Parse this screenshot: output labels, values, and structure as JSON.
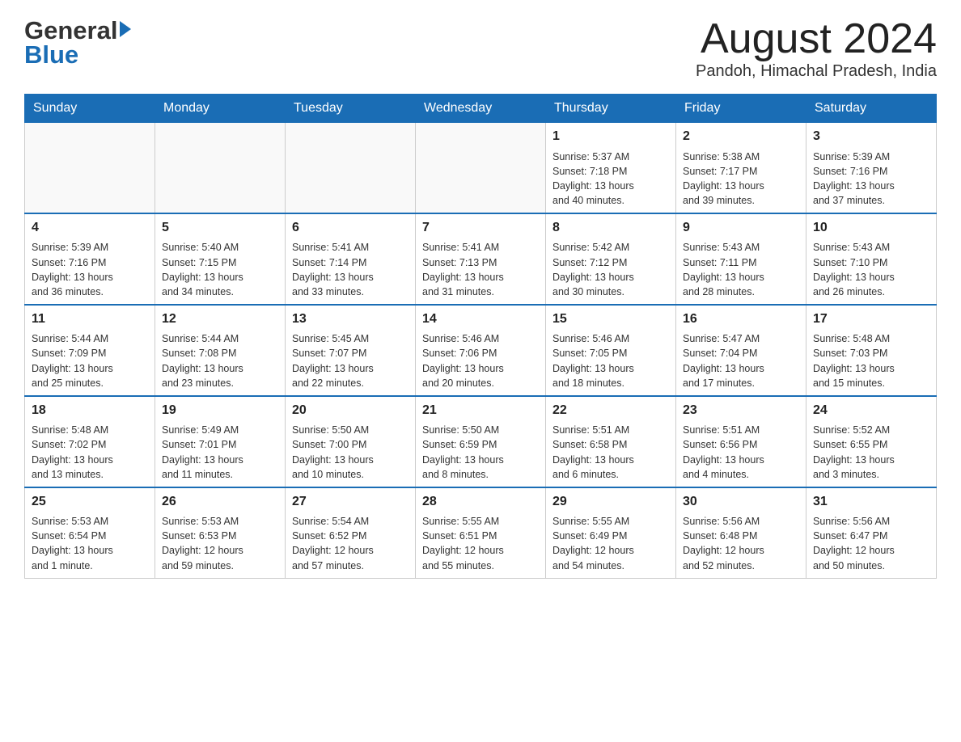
{
  "header": {
    "logo_general": "General",
    "logo_blue": "Blue",
    "month_title": "August 2024",
    "location": "Pandoh, Himachal Pradesh, India"
  },
  "weekdays": [
    "Sunday",
    "Monday",
    "Tuesday",
    "Wednesday",
    "Thursday",
    "Friday",
    "Saturday"
  ],
  "weeks": [
    [
      {
        "day": "",
        "info": ""
      },
      {
        "day": "",
        "info": ""
      },
      {
        "day": "",
        "info": ""
      },
      {
        "day": "",
        "info": ""
      },
      {
        "day": "1",
        "info": "Sunrise: 5:37 AM\nSunset: 7:18 PM\nDaylight: 13 hours\nand 40 minutes."
      },
      {
        "day": "2",
        "info": "Sunrise: 5:38 AM\nSunset: 7:17 PM\nDaylight: 13 hours\nand 39 minutes."
      },
      {
        "day": "3",
        "info": "Sunrise: 5:39 AM\nSunset: 7:16 PM\nDaylight: 13 hours\nand 37 minutes."
      }
    ],
    [
      {
        "day": "4",
        "info": "Sunrise: 5:39 AM\nSunset: 7:16 PM\nDaylight: 13 hours\nand 36 minutes."
      },
      {
        "day": "5",
        "info": "Sunrise: 5:40 AM\nSunset: 7:15 PM\nDaylight: 13 hours\nand 34 minutes."
      },
      {
        "day": "6",
        "info": "Sunrise: 5:41 AM\nSunset: 7:14 PM\nDaylight: 13 hours\nand 33 minutes."
      },
      {
        "day": "7",
        "info": "Sunrise: 5:41 AM\nSunset: 7:13 PM\nDaylight: 13 hours\nand 31 minutes."
      },
      {
        "day": "8",
        "info": "Sunrise: 5:42 AM\nSunset: 7:12 PM\nDaylight: 13 hours\nand 30 minutes."
      },
      {
        "day": "9",
        "info": "Sunrise: 5:43 AM\nSunset: 7:11 PM\nDaylight: 13 hours\nand 28 minutes."
      },
      {
        "day": "10",
        "info": "Sunrise: 5:43 AM\nSunset: 7:10 PM\nDaylight: 13 hours\nand 26 minutes."
      }
    ],
    [
      {
        "day": "11",
        "info": "Sunrise: 5:44 AM\nSunset: 7:09 PM\nDaylight: 13 hours\nand 25 minutes."
      },
      {
        "day": "12",
        "info": "Sunrise: 5:44 AM\nSunset: 7:08 PM\nDaylight: 13 hours\nand 23 minutes."
      },
      {
        "day": "13",
        "info": "Sunrise: 5:45 AM\nSunset: 7:07 PM\nDaylight: 13 hours\nand 22 minutes."
      },
      {
        "day": "14",
        "info": "Sunrise: 5:46 AM\nSunset: 7:06 PM\nDaylight: 13 hours\nand 20 minutes."
      },
      {
        "day": "15",
        "info": "Sunrise: 5:46 AM\nSunset: 7:05 PM\nDaylight: 13 hours\nand 18 minutes."
      },
      {
        "day": "16",
        "info": "Sunrise: 5:47 AM\nSunset: 7:04 PM\nDaylight: 13 hours\nand 17 minutes."
      },
      {
        "day": "17",
        "info": "Sunrise: 5:48 AM\nSunset: 7:03 PM\nDaylight: 13 hours\nand 15 minutes."
      }
    ],
    [
      {
        "day": "18",
        "info": "Sunrise: 5:48 AM\nSunset: 7:02 PM\nDaylight: 13 hours\nand 13 minutes."
      },
      {
        "day": "19",
        "info": "Sunrise: 5:49 AM\nSunset: 7:01 PM\nDaylight: 13 hours\nand 11 minutes."
      },
      {
        "day": "20",
        "info": "Sunrise: 5:50 AM\nSunset: 7:00 PM\nDaylight: 13 hours\nand 10 minutes."
      },
      {
        "day": "21",
        "info": "Sunrise: 5:50 AM\nSunset: 6:59 PM\nDaylight: 13 hours\nand 8 minutes."
      },
      {
        "day": "22",
        "info": "Sunrise: 5:51 AM\nSunset: 6:58 PM\nDaylight: 13 hours\nand 6 minutes."
      },
      {
        "day": "23",
        "info": "Sunrise: 5:51 AM\nSunset: 6:56 PM\nDaylight: 13 hours\nand 4 minutes."
      },
      {
        "day": "24",
        "info": "Sunrise: 5:52 AM\nSunset: 6:55 PM\nDaylight: 13 hours\nand 3 minutes."
      }
    ],
    [
      {
        "day": "25",
        "info": "Sunrise: 5:53 AM\nSunset: 6:54 PM\nDaylight: 13 hours\nand 1 minute."
      },
      {
        "day": "26",
        "info": "Sunrise: 5:53 AM\nSunset: 6:53 PM\nDaylight: 12 hours\nand 59 minutes."
      },
      {
        "day": "27",
        "info": "Sunrise: 5:54 AM\nSunset: 6:52 PM\nDaylight: 12 hours\nand 57 minutes."
      },
      {
        "day": "28",
        "info": "Sunrise: 5:55 AM\nSunset: 6:51 PM\nDaylight: 12 hours\nand 55 minutes."
      },
      {
        "day": "29",
        "info": "Sunrise: 5:55 AM\nSunset: 6:49 PM\nDaylight: 12 hours\nand 54 minutes."
      },
      {
        "day": "30",
        "info": "Sunrise: 5:56 AM\nSunset: 6:48 PM\nDaylight: 12 hours\nand 52 minutes."
      },
      {
        "day": "31",
        "info": "Sunrise: 5:56 AM\nSunset: 6:47 PM\nDaylight: 12 hours\nand 50 minutes."
      }
    ]
  ]
}
